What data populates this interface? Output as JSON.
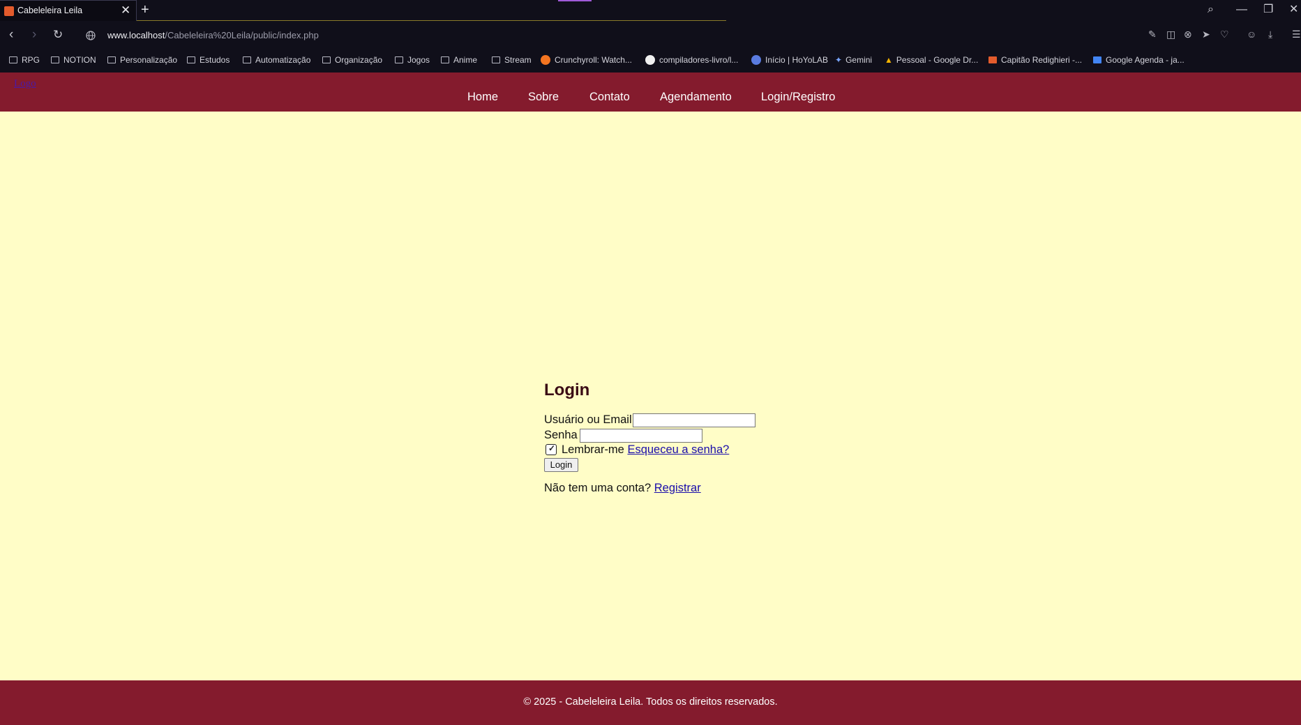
{
  "browser": {
    "tab_title": "Cabeleleira Leila",
    "tab_close": "✕",
    "new_tab": "+",
    "url_host": "www.localhost",
    "url_path": "/Cabeleleira%20Leila/public/index.php",
    "back": "‹",
    "forward": "›",
    "reload": "↻",
    "window_minimize": "—",
    "window_restore": "❐",
    "window_close": "✕",
    "search": "⌕",
    "bookmarks": [
      "RPG",
      "NOTION",
      "Personalização",
      "Estudos",
      "Automatização",
      "Organização",
      "Jogos",
      "Anime",
      "Stream",
      "Crunchyroll: Watch...",
      "compiladores-livro/l...",
      "Início | HoYoLAB",
      "Gemini",
      "Pessoal - Google Dr...",
      "Capitão Redighieri -...",
      "Google Agenda - ja..."
    ]
  },
  "site": {
    "logo": "Logo",
    "nav": [
      "Home",
      "Sobre",
      "Contato",
      "Agendamento",
      "Login/Registro"
    ],
    "login": {
      "title": "Login",
      "user_label": "Usuário ou Email",
      "user_value": "",
      "password_label": "Senha",
      "password_value": "",
      "remember_label": "Lembrar-me",
      "remember_checked": true,
      "forgot_link": "Esqueceu a senha?",
      "submit": "Login",
      "no_account": "Não tem uma conta?",
      "register_link": "Registrar"
    },
    "footer": "© 2025 - Cabeleleira Leila. Todos os direitos reservados."
  },
  "colors": {
    "header_bg": "#841b2d",
    "page_bg": "#fffdc7",
    "link": "#1a0dab"
  }
}
